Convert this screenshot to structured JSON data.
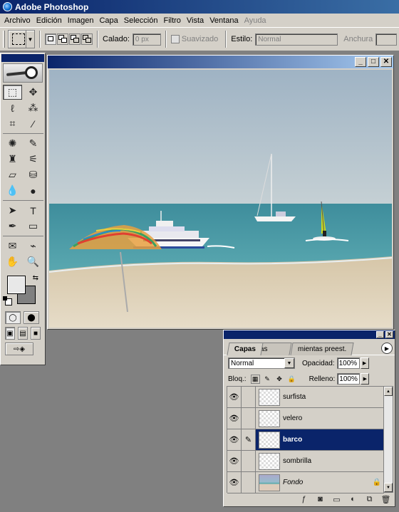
{
  "app": {
    "title": "Adobe Photoshop"
  },
  "menu": [
    "Archivo",
    "Edición",
    "Imagen",
    "Capa",
    "Selección",
    "Filtro",
    "Vista",
    "Ventana",
    "Ayuda"
  ],
  "options": {
    "calado_label": "Calado:",
    "calado_value": "0 px",
    "suavizado_label": "Suavizado",
    "estilo_label": "Estilo:",
    "estilo_value": "Normal",
    "anchura_label": "Anchura"
  },
  "toolbox": {
    "tools": [
      {
        "name": "rectangular-marquee-icon",
        "glyph": "⬚",
        "selected": true
      },
      {
        "name": "move-icon",
        "glyph": "✥"
      },
      {
        "name": "lasso-icon",
        "glyph": "ℓ"
      },
      {
        "name": "magic-wand-icon",
        "glyph": "⁂"
      },
      {
        "name": "crop-icon",
        "glyph": "⌗"
      },
      {
        "name": "slice-icon",
        "glyph": "⁄"
      },
      {
        "name": "healing-brush-icon",
        "glyph": "✺"
      },
      {
        "name": "brush-icon",
        "glyph": "✎"
      },
      {
        "name": "clone-stamp-icon",
        "glyph": "♜"
      },
      {
        "name": "history-brush-icon",
        "glyph": "⚟"
      },
      {
        "name": "eraser-icon",
        "glyph": "▱"
      },
      {
        "name": "paint-bucket-icon",
        "glyph": "⛁"
      },
      {
        "name": "blur-icon",
        "glyph": "💧"
      },
      {
        "name": "dodge-icon",
        "glyph": "●"
      },
      {
        "name": "path-selection-icon",
        "glyph": "➤"
      },
      {
        "name": "type-icon",
        "glyph": "T"
      },
      {
        "name": "pen-icon",
        "glyph": "✒"
      },
      {
        "name": "rectangle-shape-icon",
        "glyph": "▭"
      },
      {
        "name": "notes-icon",
        "glyph": "✉"
      },
      {
        "name": "eyedropper-icon",
        "glyph": "⌁"
      },
      {
        "name": "hand-icon",
        "glyph": "✋"
      },
      {
        "name": "zoom-icon",
        "glyph": "🔍"
      }
    ],
    "foreground_color": "#e8e8e8",
    "background_color": "#808080"
  },
  "document": {
    "title": "",
    "colors": {
      "sky": "#a6b8c6",
      "sea": "#4a9aaa",
      "sand": "#ddd0b8"
    }
  },
  "layers_panel": {
    "tabs": [
      "Capas",
      "as",
      "mientas preest."
    ],
    "blend_mode": "Normal",
    "opacity_label": "Opacidad:",
    "opacity_value": "100%",
    "lock_label": "Bloq.:",
    "fill_label": "Relleno:",
    "fill_value": "100%",
    "layers": [
      {
        "name": "surfista",
        "visible": true,
        "selected": false
      },
      {
        "name": "velero",
        "visible": true,
        "selected": false
      },
      {
        "name": "barco",
        "visible": true,
        "selected": true
      },
      {
        "name": "sombrilla",
        "visible": true,
        "selected": false
      },
      {
        "name": "Fondo",
        "visible": true,
        "selected": false,
        "locked": true
      }
    ]
  }
}
